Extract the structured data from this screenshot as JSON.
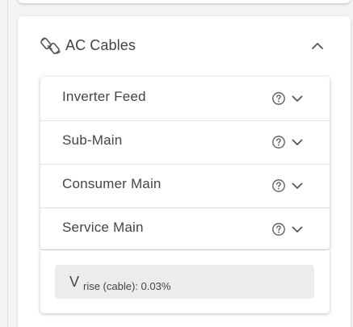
{
  "section": {
    "title": "AC Cables",
    "icon": "cable-icon",
    "collapse_icon": "chevron-up-icon"
  },
  "cables": [
    {
      "label": "Inverter Feed"
    },
    {
      "label": "Sub-Main"
    },
    {
      "label": "Consumer Main"
    },
    {
      "label": "Service Main"
    }
  ],
  "row_icons": {
    "help": "help-circle-icon",
    "expand": "chevron-down-icon"
  },
  "result": {
    "symbol": "V",
    "subscript": "rise (cable): 0.03%"
  },
  "colors": {
    "text": "#444444",
    "background": "#f4f4f4",
    "card": "#ffffff",
    "result_box": "#ececec"
  }
}
